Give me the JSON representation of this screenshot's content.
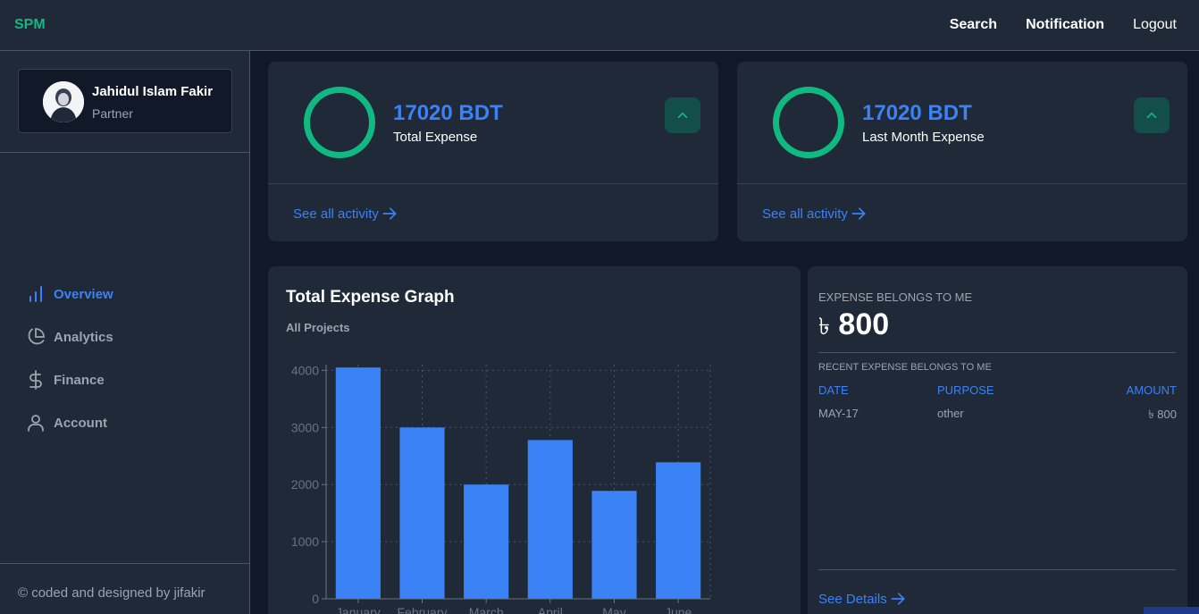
{
  "header": {
    "brand": "SPM",
    "nav": [
      "Search",
      "Notification",
      "Logout"
    ]
  },
  "profile": {
    "name": "Jahidul Islam Fakir",
    "role": "Partner"
  },
  "menu": [
    {
      "label": "Overview",
      "icon": "bar-chart-icon",
      "active": true
    },
    {
      "label": "Analytics",
      "icon": "pie-chart-icon",
      "active": false
    },
    {
      "label": "Finance",
      "icon": "dollar-icon",
      "active": false
    },
    {
      "label": "Account",
      "icon": "user-icon",
      "active": false
    }
  ],
  "footer": "© coded and designed by jifakir",
  "stats": [
    {
      "value": "17020 BDT",
      "label": "Total Expense",
      "link": "See all activity"
    },
    {
      "value": "17020 BDT",
      "label": "Last Month Expense",
      "link": "See all activity"
    }
  ],
  "graph": {
    "title": "Total Expense Graph",
    "subtitle": "All Projects"
  },
  "chart_data": {
    "type": "bar",
    "categories": [
      "January",
      "February",
      "March",
      "April",
      "May",
      "June"
    ],
    "values": [
      4050,
      3000,
      2000,
      2780,
      1890,
      2390
    ],
    "yticks": [
      0,
      1000,
      2000,
      3000,
      4000
    ],
    "ylim": [
      0,
      4100
    ],
    "grid": true,
    "bar_color": "#3b82f6"
  },
  "expense": {
    "label": "EXPENSE BELONGS TO ME",
    "currency": "৳",
    "amount": "800",
    "recent_label": "RECENT EXPENSE BELONGS TO ME",
    "headers": [
      "DATE",
      "PURPOSE",
      "AMOUNT"
    ],
    "rows": [
      {
        "date": "MAY-17",
        "purpose": "other",
        "amount": "৳ 800"
      }
    ],
    "details_link": "See Details"
  },
  "colors": {
    "accent": "#3b82f6",
    "green": "#10b981",
    "panel": "#1f2937",
    "background": "#111827"
  }
}
